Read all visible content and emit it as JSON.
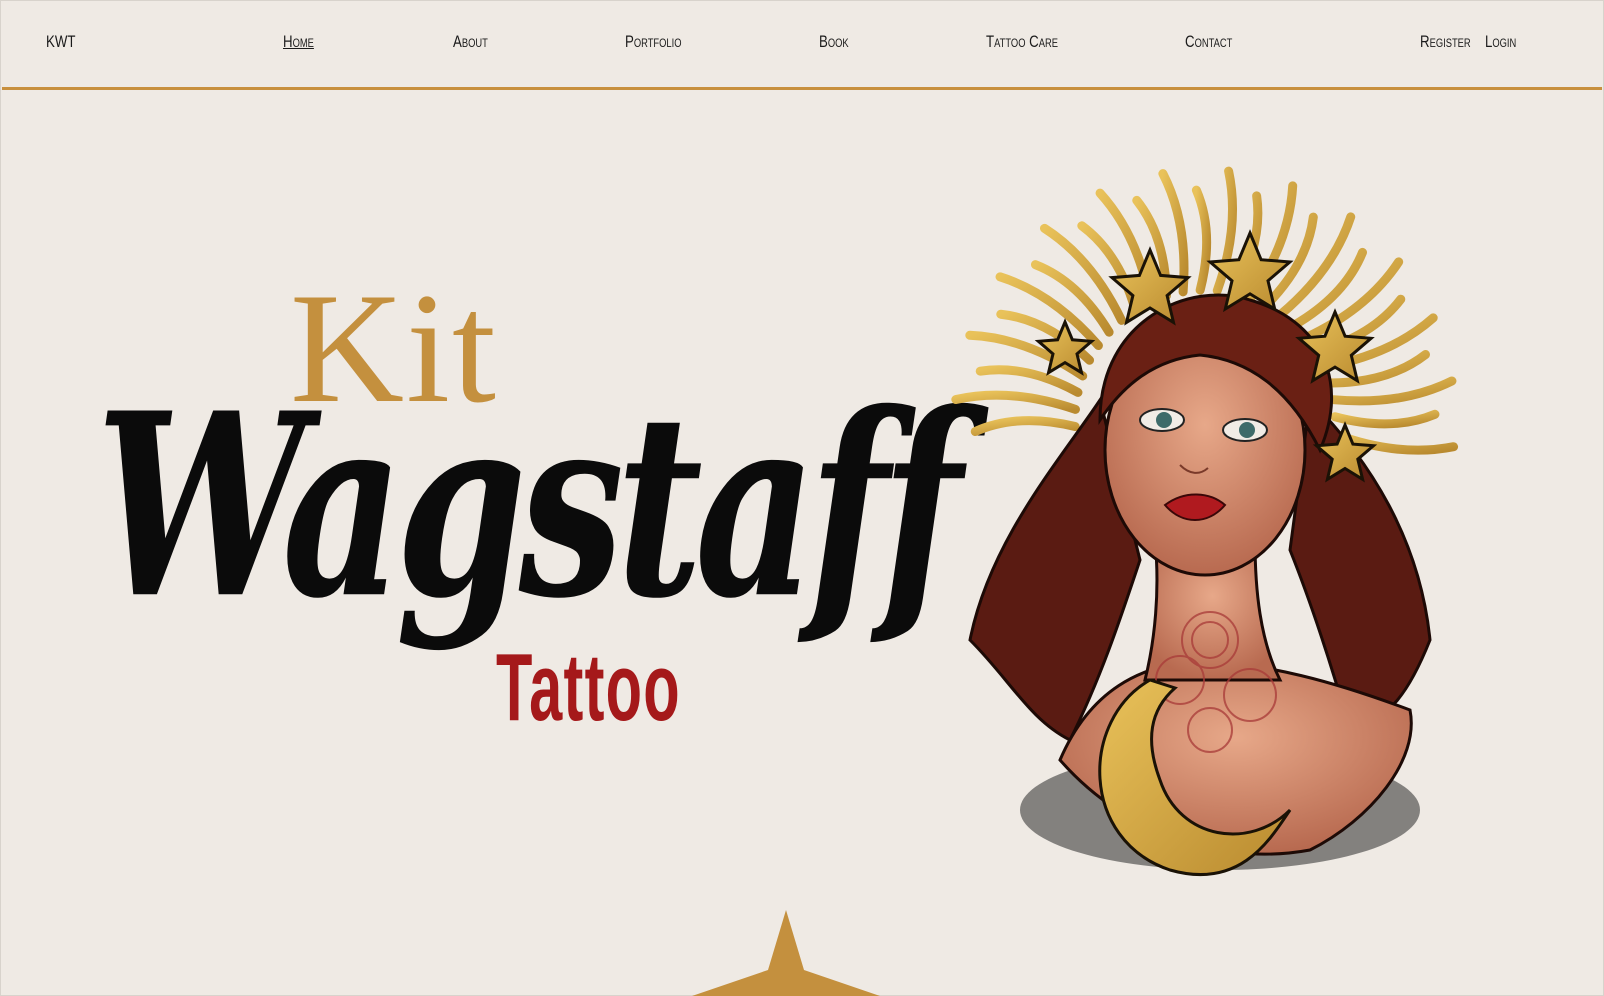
{
  "nav": {
    "logo": "KWT",
    "items": [
      {
        "label": "Home",
        "active": true
      },
      {
        "label": "About",
        "active": false
      },
      {
        "label": "Portfolio",
        "active": false
      },
      {
        "label": "Book",
        "active": false
      },
      {
        "label": "Tattoo Care",
        "active": false
      },
      {
        "label": "Contact",
        "active": false
      }
    ],
    "register": "Register",
    "login": "Login"
  },
  "hero": {
    "first": "Kit",
    "last": "Wagstaff",
    "sub": "Tattoo"
  },
  "colors": {
    "background": "#efeae4",
    "accent_gold": "#c4903e",
    "nav_rule": "#c8903e",
    "title_black": "#0b0b0b",
    "tattoo_red": "#a5191a"
  },
  "icons": [
    "sun-woman-illustration",
    "crescent-moon-icon",
    "star-icon"
  ]
}
